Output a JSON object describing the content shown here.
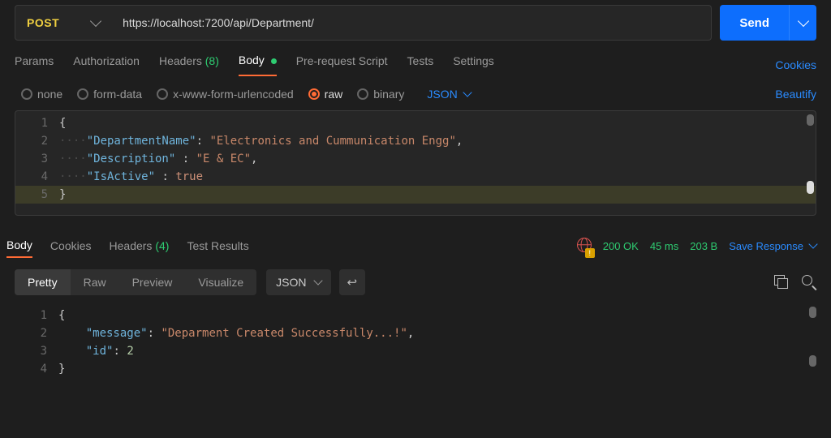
{
  "request": {
    "method": "POST",
    "url": "https://localhost:7200/api/Department/",
    "send_label": "Send"
  },
  "req_tabs": {
    "params": "Params",
    "authorization": "Authorization",
    "headers": "Headers",
    "headers_count": "(8)",
    "body": "Body",
    "prerequest": "Pre-request Script",
    "tests": "Tests",
    "settings": "Settings",
    "cookies": "Cookies"
  },
  "body_options": {
    "none": "none",
    "formdata": "form-data",
    "xwww": "x-www-form-urlencoded",
    "raw": "raw",
    "binary": "binary",
    "type": "JSON",
    "beautify": "Beautify"
  },
  "request_body_lines": [
    "{",
    "····\"DepartmentName\": \"Electronics and Cummunication Engg\",",
    "····\"Description\" : \"E & EC\",",
    "····\"IsActive\" : true",
    "}"
  ],
  "chart_data": {
    "type": "table",
    "title": "Request JSON body",
    "data": {
      "DepartmentName": "Electronics and Cummunication Engg",
      "Description": "E & EC",
      "IsActive": true
    }
  },
  "resp_tabs": {
    "body": "Body",
    "cookies": "Cookies",
    "headers": "Headers",
    "headers_count": "(4)",
    "test_results": "Test Results"
  },
  "status": {
    "code": "200 OK",
    "time": "45 ms",
    "size": "203 B",
    "save": "Save Response"
  },
  "views": {
    "pretty": "Pretty",
    "raw": "Raw",
    "preview": "Preview",
    "visualize": "Visualize",
    "type": "JSON"
  },
  "response_body_lines": [
    "{",
    "    \"message\": \"Deparment Created Successfully...!\",",
    "    \"id\": 2",
    "}"
  ],
  "response_chart_data": {
    "type": "table",
    "title": "Response JSON body",
    "data": {
      "message": "Deparment Created Successfully...!",
      "id": 2
    }
  }
}
